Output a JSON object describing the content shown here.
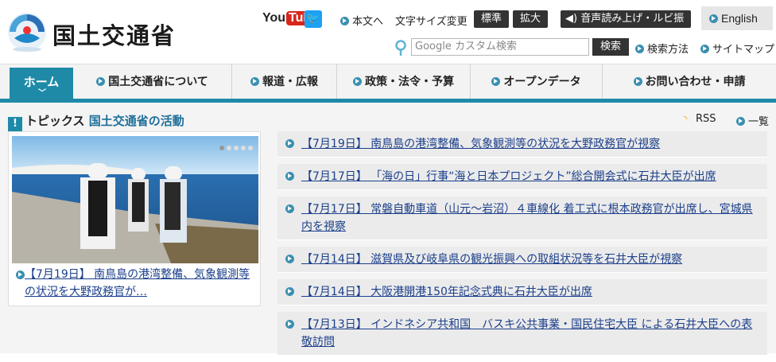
{
  "header": {
    "logo_text": "国土交通省",
    "youtube": {
      "you": "You",
      "tube": "Tube"
    },
    "twitter_icon": "twitter-bird-icon",
    "links": {
      "main_text": "本文へ",
      "font_size_label": "文字サイズ変更",
      "font_standard": "標準",
      "font_large": "拡大",
      "speech": "音声読み上げ・ルビ振り",
      "english": "English"
    },
    "search": {
      "placeholder": "Google カスタム検索",
      "button": "検索",
      "method": "検索方法",
      "sitemap": "サイトマップ"
    }
  },
  "nav": {
    "home": "ホーム",
    "items": [
      "国土交通省について",
      "報道・広報",
      "政策・法令・予算",
      "オープンデータ",
      "お問い合わせ・申請"
    ]
  },
  "topics": {
    "label": "トピックス",
    "sub": "国土交通省の活動",
    "rss": "RSS",
    "all": "一覧"
  },
  "feature": {
    "caption": "【7月19日】 南鳥島の港湾整備、気象観測等の状況を大野政務官が…"
  },
  "news": [
    "【7月19日】 南鳥島の港湾整備、気象観測等の状況を大野政務官が視察",
    "【7月17日】 「海の日」行事“海と日本プロジェクト”総合開会式に石井大臣が出席",
    "【7月17日】 常磐自動車道（山元～岩沼）４車線化 着工式に根本政務官が出席し、宮城県内を視察",
    "【7月14日】 滋賀県及び岐阜県の観光振興への取組状況等を石井大臣が視察",
    "【7月14日】 大阪港開港150年記念式典に石井大臣が出席",
    "【7月13日】 インドネシア共和国　バスキ公共事業・国民住宅大臣 による石井大臣への表敬訪問"
  ],
  "colors": {
    "accent": "#1f8aa8",
    "link": "#1b3f8a",
    "youtube_red": "#d8261d"
  }
}
